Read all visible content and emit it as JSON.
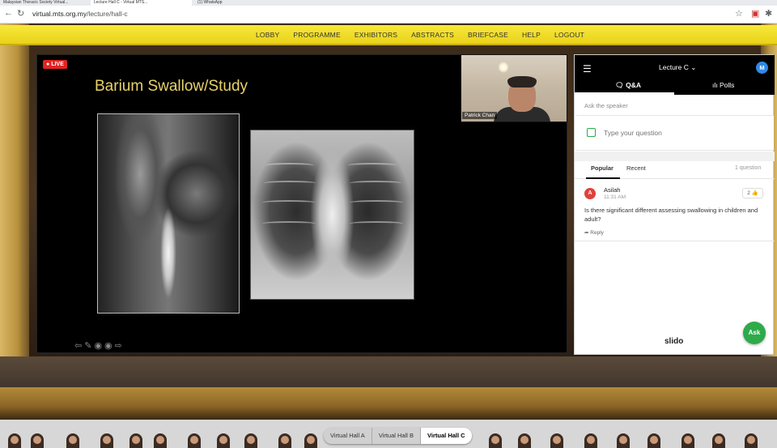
{
  "browser": {
    "tabs": [
      {
        "label": "Malaysian Thoracic Society Virtual..."
      },
      {
        "label": "Lecture Hall C - Virtual MTS..."
      },
      {
        "label": "(1) WhatsApp"
      }
    ],
    "url_host": "virtual.mts.org.my",
    "url_path": "/lecture/hall-c"
  },
  "topnav": {
    "items": [
      "LOBBY",
      "PROGRAMME",
      "EXHIBITORS",
      "ABSTRACTS",
      "BRIEFCASE",
      "HELP",
      "LOGOUT"
    ]
  },
  "player": {
    "live_badge": "LIVE",
    "slide_title": "Barium Swallow/Study",
    "presenter_name": "Patrick Chan"
  },
  "slido": {
    "event_title": "Lecture C",
    "avatar_letter": "M",
    "tabs": [
      "Q&A",
      "Polls"
    ],
    "ask_label": "Ask the speaker",
    "question_placeholder": "Type your question",
    "list_tabs": [
      "Popular",
      "Recent"
    ],
    "question_count": "1 question",
    "question": {
      "avatar_letter": "A",
      "author": "Asilah",
      "time": "11:31 AM",
      "likes": "2",
      "text": "Is there significant different assessing swallowing in children and adult?",
      "reply_label": "Reply"
    },
    "brand": "slido",
    "ask_button": "Ask"
  },
  "halls": [
    "Virtual Hall A",
    "Virtual Hall B",
    "Virtual Hall C"
  ],
  "active_hall": "Virtual Hall C"
}
